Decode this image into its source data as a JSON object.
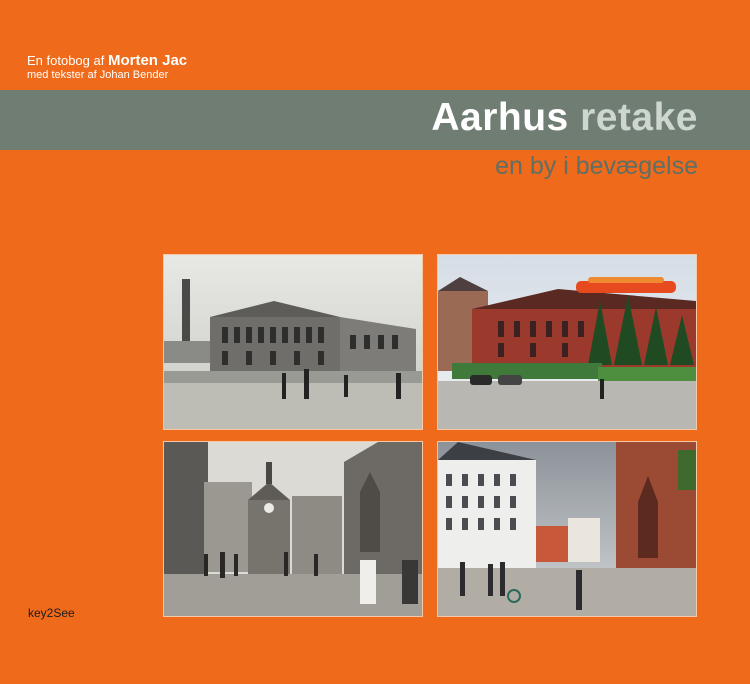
{
  "credit": {
    "prefix": "En fotobog af ",
    "author": "Morten Jac",
    "texts": "med tekster af Johan Bender"
  },
  "title": {
    "word1": "Aarhus",
    "word2": "retake"
  },
  "subtitle": "en by i bevægelse",
  "publisher": "key2See",
  "colors": {
    "background": "#ef6a1a",
    "band": "#6f7d72",
    "subtitle": "#5f6f66"
  }
}
